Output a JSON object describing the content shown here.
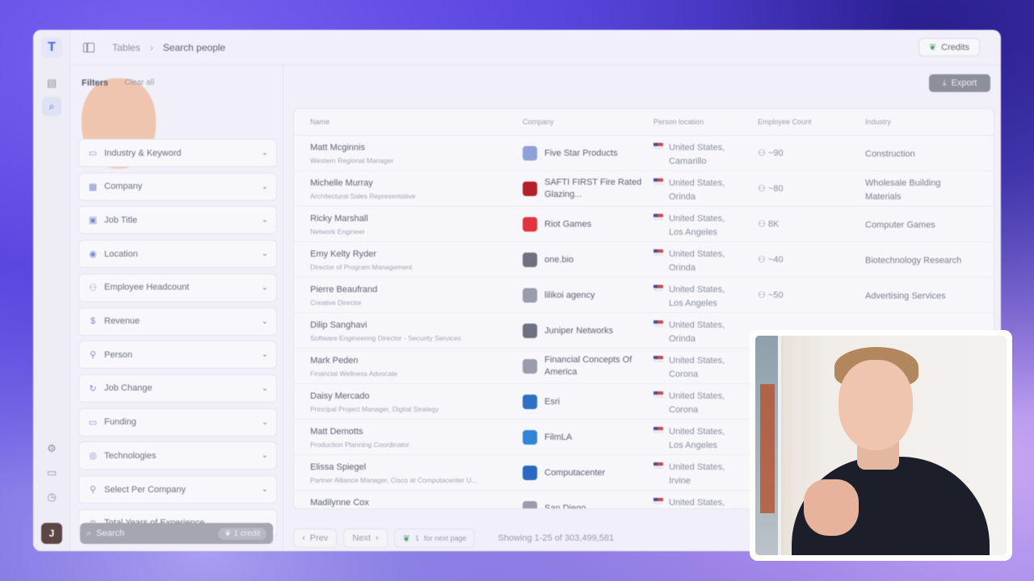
{
  "breadcrumb": {
    "parent": "Tables",
    "current": "Search people"
  },
  "credits_label": "Credits",
  "filters": {
    "title": "Filters",
    "clear_label": "Clear all",
    "items": [
      {
        "label": "Industry & Keyword",
        "icon": "folder-icon"
      },
      {
        "label": "Company",
        "icon": "building-icon"
      },
      {
        "label": "Job Title",
        "icon": "briefcase-icon"
      },
      {
        "label": "Location",
        "icon": "pin-icon"
      },
      {
        "label": "Employee Headcount",
        "icon": "people-icon"
      },
      {
        "label": "Revenue",
        "icon": "dollar-icon"
      },
      {
        "label": "Person",
        "icon": "person-icon"
      },
      {
        "label": "Job Change",
        "icon": "refresh-icon"
      },
      {
        "label": "Funding",
        "icon": "money-icon"
      },
      {
        "label": "Technologies",
        "icon": "globe-icon"
      },
      {
        "label": "Select Per Company",
        "icon": "person-check-icon"
      },
      {
        "label": "Total Years of Experience",
        "icon": "clock-icon"
      }
    ],
    "search_label": "Search",
    "search_credit": "1 credit"
  },
  "export_label": "Export",
  "table": {
    "headers": [
      "Name",
      "Company",
      "Person location",
      "Employee Count",
      "Industry"
    ],
    "rows": [
      {
        "name": "Matt Mcginnis",
        "title": "Western Regional Manager",
        "company": "Five Star Products",
        "logo_color": "#8fa1d4",
        "loc1": "United States,",
        "loc2": "Camarillo",
        "emp": "~90",
        "industry": "Construction"
      },
      {
        "name": "Michelle Murray",
        "title": "Architectural Sales Representative",
        "company": "SAFTI FIRST Fire Rated Glazing...",
        "logo_color": "#b4202a",
        "loc1": "United States,",
        "loc2": "Orinda",
        "emp": "~80",
        "industry": "Wholesale Building Materials"
      },
      {
        "name": "Ricky Marshall",
        "title": "Network Engineer",
        "company": "Riot Games",
        "logo_color": "#e0353d",
        "loc1": "United States,",
        "loc2": "Los Angeles",
        "emp": "8K",
        "industry": "Computer Games"
      },
      {
        "name": "Emy Kelty Ryder",
        "title": "Director of Program Management",
        "company": "one.bio",
        "logo_color": "#6f7180",
        "loc1": "United States,",
        "loc2": "Orinda",
        "emp": "~40",
        "industry": "Biotechnology Research"
      },
      {
        "name": "Pierre Beaufrand",
        "title": "Creative Director",
        "company": "lilikoi agency",
        "logo_color": "#9a9cab",
        "loc1": "United States,",
        "loc2": "Los Angeles",
        "emp": "~50",
        "industry": "Advertising Services"
      },
      {
        "name": "Dilip Sanghavi",
        "title": "Software Engineering Director - Security Services",
        "company": "Juniper Networks",
        "logo_color": "#6f7180",
        "loc1": "United States,",
        "loc2": "Orinda",
        "emp": "",
        "industry": ""
      },
      {
        "name": "Mark Peden",
        "title": "Financial Wellness Advocate",
        "company": "Financial Concepts Of America",
        "logo_color": "#9a9cab",
        "loc1": "United States,",
        "loc2": "Corona",
        "emp": "",
        "industry": ""
      },
      {
        "name": "Daisy Mercado",
        "title": "Principal Project Manager, Digital Strategy",
        "company": "Esri",
        "logo_color": "#2f6fc4",
        "loc1": "United States,",
        "loc2": "Corona",
        "emp": "",
        "industry": ""
      },
      {
        "name": "Matt Demotts",
        "title": "Production Planning Coordinator",
        "company": "FilmLA",
        "logo_color": "#2f86d6",
        "loc1": "United States,",
        "loc2": "Los Angeles",
        "emp": "",
        "industry": ""
      },
      {
        "name": "Elissa Spiegel",
        "title": "Partner Alliance Manager, Cisco at Computacenter U...",
        "company": "Computacenter",
        "logo_color": "#2a68c2",
        "loc1": "United States,",
        "loc2": "Irvine",
        "emp": "",
        "industry": ""
      },
      {
        "name": "Madilynne Cox",
        "title": "",
        "company": "San Diego",
        "logo_color": "#9a9cab",
        "loc1": "United States,",
        "loc2": "",
        "emp": "",
        "industry": ""
      }
    ]
  },
  "pagination": {
    "prev_label": "Prev",
    "next_label": "Next",
    "credit_count": "1",
    "credit_suffix": "for next page",
    "showing": "Showing 1-25 of 303,499,581"
  },
  "rail_avatar": "J",
  "logo_letter": "T"
}
